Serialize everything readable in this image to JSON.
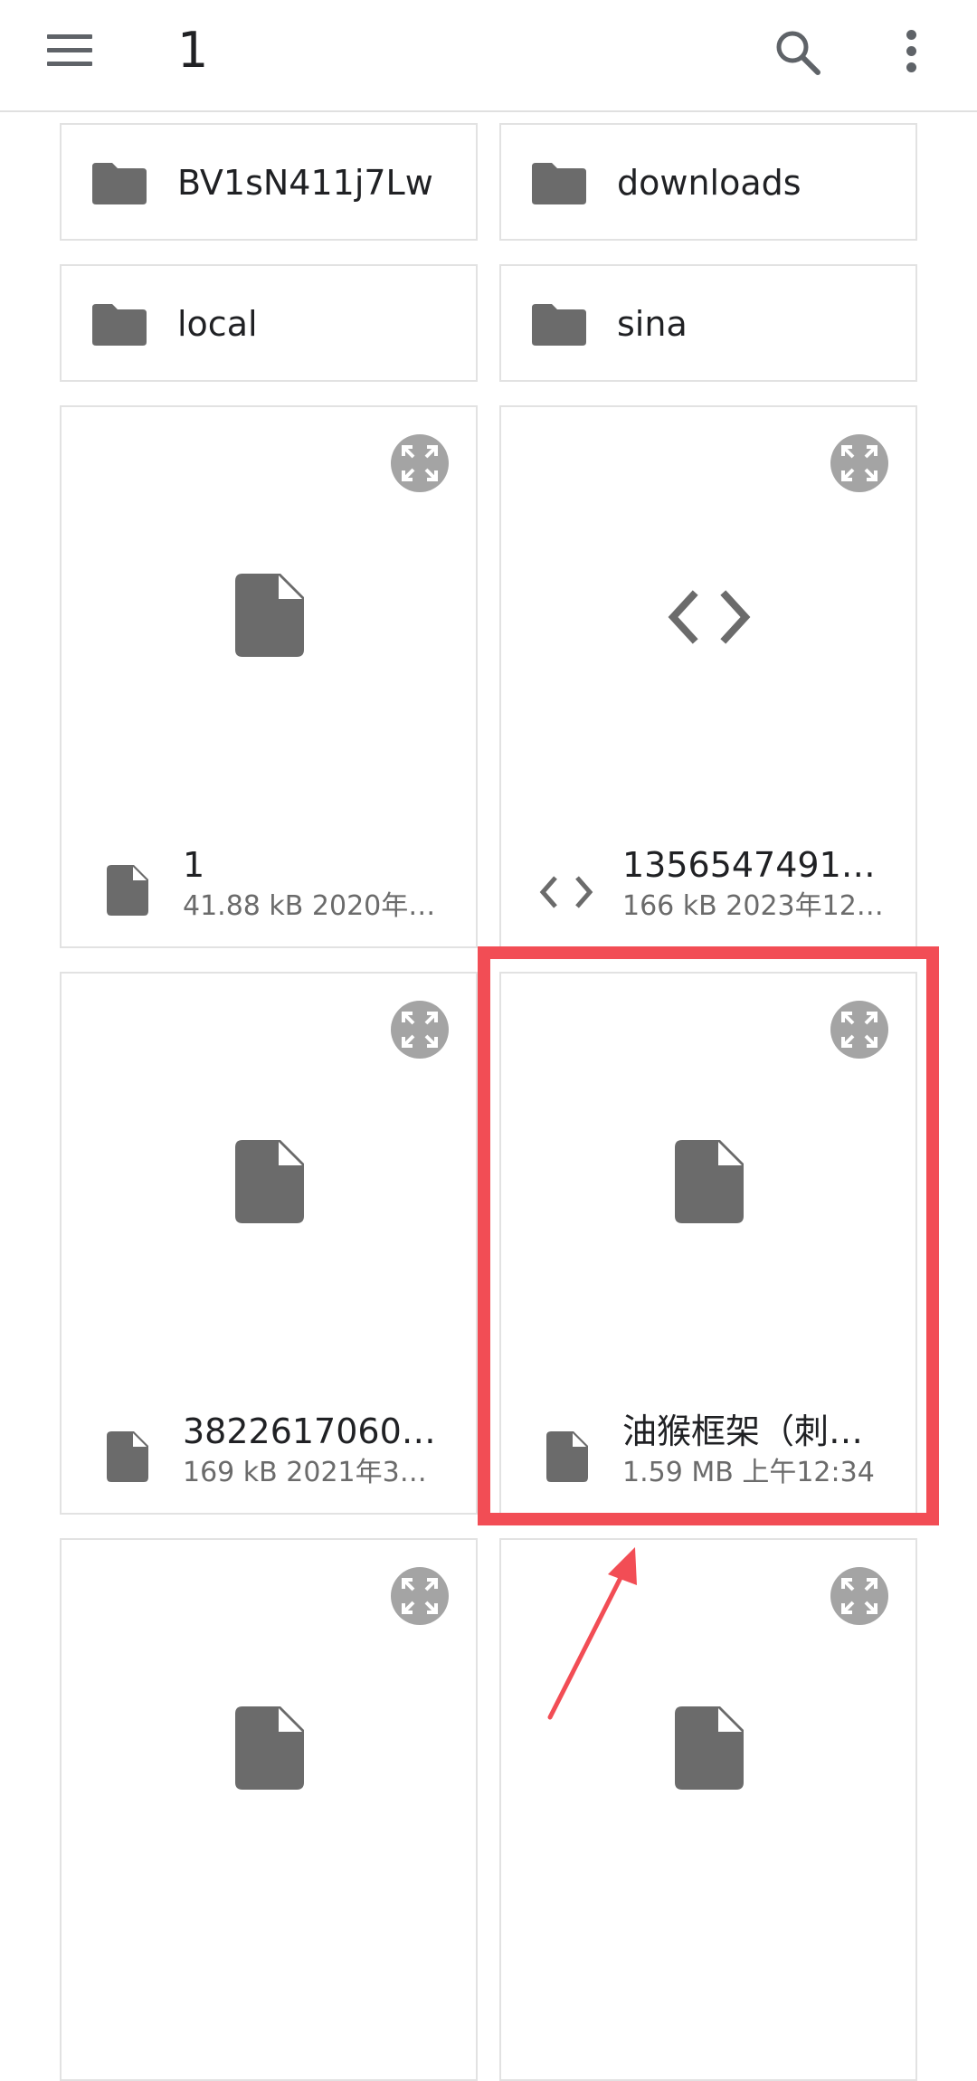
{
  "toolbar": {
    "title": "1",
    "menu_icon": "menu-icon",
    "search_icon": "search-icon",
    "more_icon": "more-vert-icon"
  },
  "folders": [
    {
      "name": "BV1sN411j7Lw",
      "icon": "folder-icon"
    },
    {
      "name": "downloads",
      "icon": "folder-icon"
    },
    {
      "name": "local",
      "icon": "folder-icon"
    },
    {
      "name": "sina",
      "icon": "folder-icon"
    }
  ],
  "files": [
    {
      "name": "1",
      "meta": "41.88 kB 2020年…",
      "icon": "file-icon"
    },
    {
      "name": "1356547491_…",
      "meta": "166 kB 2023年12…",
      "icon": "code-icon"
    },
    {
      "name": "38226170601…",
      "meta": "169 kB 2021年3…",
      "icon": "file-icon"
    },
    {
      "name": "油猴框架（刺…",
      "meta": "1.59 MB 上午12:34",
      "icon": "file-icon"
    },
    {
      "name": "",
      "meta": "",
      "icon": "file-icon"
    },
    {
      "name": "",
      "meta": "",
      "icon": "file-icon"
    }
  ],
  "colors": {
    "highlight": "#f24d55",
    "icon": "#6b6b6b",
    "expand_button": "#a4a4a4"
  }
}
